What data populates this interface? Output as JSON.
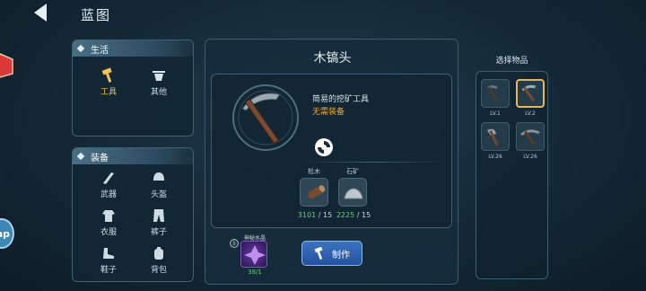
{
  "header": {
    "title": "蓝图"
  },
  "life_panel": {
    "title": "生活",
    "items": [
      {
        "label": "工具",
        "icon": "hammer-icon",
        "active": true
      },
      {
        "label": "其他",
        "icon": "cauldron-icon",
        "active": false
      }
    ]
  },
  "equip_panel": {
    "title": "装备",
    "items": [
      {
        "label": "武器",
        "icon": "weapon-icon"
      },
      {
        "label": "头盔",
        "icon": "helmet-icon"
      },
      {
        "label": "衣服",
        "icon": "clothes-icon"
      },
      {
        "label": "裤子",
        "icon": "pants-icon"
      },
      {
        "label": "鞋子",
        "icon": "shoes-icon"
      },
      {
        "label": "背包",
        "icon": "backpack-icon"
      }
    ]
  },
  "item": {
    "name": "木镐头",
    "description": "简易的挖矿工具",
    "requirement": "无需装备",
    "icon": "pickaxe-icon"
  },
  "materials": [
    {
      "name": "松木",
      "have": "3101",
      "need": "/ 15",
      "icon": "log-icon"
    },
    {
      "name": "石矿",
      "have": "2225",
      "need": "/ 15",
      "icon": "stone-icon"
    }
  ],
  "bottom_item": {
    "label": "神秘水晶",
    "count": "38/1",
    "icon": "crystal-icon"
  },
  "craft_button": {
    "label": "制作"
  },
  "selector": {
    "title": "选择物品",
    "slots": [
      {
        "level": "LV.1",
        "icon": "stone-pick-icon",
        "selected": false
      },
      {
        "level": "LV.2",
        "icon": "pickaxe-icon",
        "selected": true
      },
      {
        "level": "LV.26",
        "icon": "axe-icon",
        "selected": false
      },
      {
        "level": "LV.26",
        "icon": "iron-pick-icon",
        "selected": false
      }
    ]
  },
  "colors": {
    "accent": "#f2c14e",
    "have": "#5ed36b",
    "warn": "#e8a93a",
    "button": "#2e62b0"
  },
  "edge": {
    "map_label": "ap"
  }
}
